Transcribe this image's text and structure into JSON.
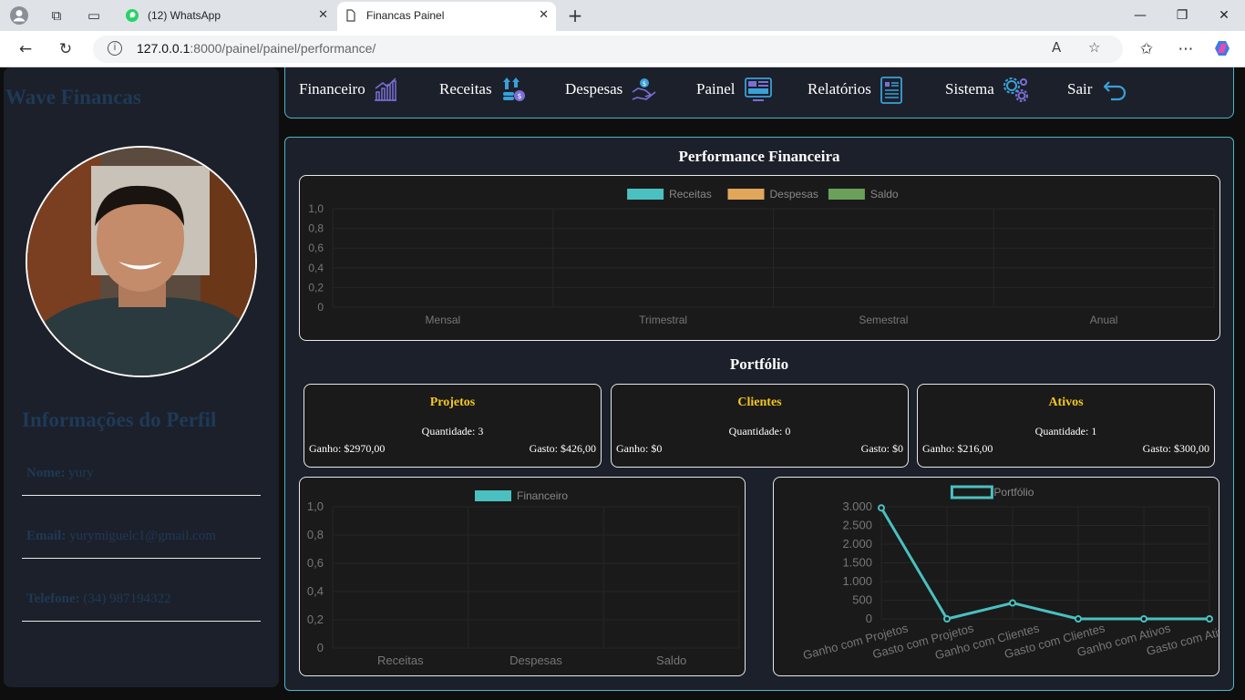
{
  "browser": {
    "tabs": [
      {
        "title": "(12) WhatsApp",
        "active": false
      },
      {
        "title": "Financas Painel",
        "active": true
      }
    ],
    "url_host": "127.0.0.1",
    "url_path": ":8000/painel/painel/performance/"
  },
  "sidebar": {
    "brand": "Wave Financas",
    "profile_title": "Informações do Perfil",
    "fields": [
      {
        "label": "Nome:",
        "value": "yury"
      },
      {
        "label": "Email:",
        "value": "yurymiguelc1@gmail.com"
      },
      {
        "label": "Telefone:",
        "value": "(34) 987194322"
      }
    ]
  },
  "nav": [
    {
      "label": "Financeiro",
      "icon": "bar-chart-icon"
    },
    {
      "label": "Receitas",
      "icon": "money-up-icon"
    },
    {
      "label": "Despesas",
      "icon": "hand-money-icon"
    },
    {
      "label": "Painel",
      "icon": "dashboard-icon"
    },
    {
      "label": "Relatórios",
      "icon": "report-icon"
    },
    {
      "label": "Sistema",
      "icon": "gears-icon"
    },
    {
      "label": "Sair",
      "icon": "return-arrow-icon"
    }
  ],
  "main": {
    "performance_title": "Performance Financeira",
    "portfolio_title": "Portfólio",
    "cards": [
      {
        "title": "Projetos",
        "quantity": "Quantidade: 3",
        "gain": "Ganho: $2970,00",
        "spent": "Gasto: $426,00"
      },
      {
        "title": "Clientes",
        "quantity": "Quantidade: 0",
        "gain": "Ganho: $0",
        "spent": "Gasto: $0"
      },
      {
        "title": "Ativos",
        "quantity": "Quantidade: 1",
        "gain": "Ganho: $216,00",
        "spent": "Gasto: $300,00"
      }
    ]
  },
  "colors": {
    "receitas": "#4bc0c0",
    "despesas": "#e0a65a",
    "saldo": "#6aa05a",
    "accent": "#4db4c6",
    "card_title": "#f4c622"
  },
  "chart_data": [
    {
      "type": "bar",
      "categories": [
        "Mensal",
        "Trimestral",
        "Semestral",
        "Anual"
      ],
      "series": [
        {
          "name": "Receitas",
          "values": [
            0,
            0,
            0,
            0
          ]
        },
        {
          "name": "Despesas",
          "values": [
            0,
            0,
            0,
            0
          ]
        },
        {
          "name": "Saldo",
          "values": [
            0,
            0,
            0,
            0
          ]
        }
      ],
      "yticks": [
        "0",
        "0,2",
        "0,4",
        "0,6",
        "0,8",
        "1,0"
      ],
      "ylim": [
        0,
        1
      ],
      "legend": "top"
    },
    {
      "type": "bar",
      "categories": [
        "Receitas",
        "Despesas",
        "Saldo"
      ],
      "series": [
        {
          "name": "Financeiro",
          "values": [
            0,
            0,
            0
          ]
        }
      ],
      "yticks": [
        "0",
        "0,2",
        "0,4",
        "0,6",
        "0,8",
        "1,0"
      ],
      "ylim": [
        0,
        1
      ],
      "legend": "top"
    },
    {
      "type": "line",
      "categories": [
        "Ganho com Projetos",
        "Gasto com Projetos",
        "Ganho com Clientes",
        "Gasto com Clientes",
        "Ganho com Ativos",
        "Gasto com Ativos"
      ],
      "series": [
        {
          "name": "Portfólio",
          "values": [
            2970,
            0,
            426,
            0,
            0,
            0
          ]
        }
      ],
      "yticks": [
        "0",
        "500",
        "1.000",
        "1.500",
        "2.000",
        "2.500",
        "3.000"
      ],
      "ylim": [
        0,
        3000
      ],
      "legend": "top"
    }
  ]
}
